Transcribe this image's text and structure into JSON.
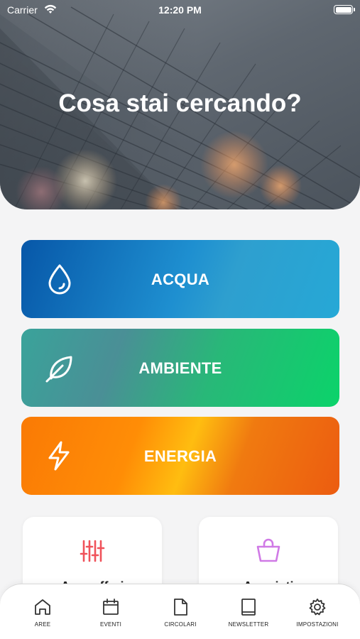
{
  "status_bar": {
    "carrier": "Carrier",
    "time": "12:20 PM"
  },
  "hero": {
    "title": "Cosa stai cercando?"
  },
  "categories": [
    {
      "label": "ACQUA",
      "icon": "water-drop-icon",
      "colors": [
        "#0757a8",
        "#26a8d6"
      ]
    },
    {
      "label": "AMBIENTE",
      "icon": "leaf-icon",
      "colors": [
        "#3aa39a",
        "#0bd36a"
      ]
    },
    {
      "label": "ENERGIA",
      "icon": "lightning-icon",
      "colors": [
        "#fa7a05",
        "#ffbd10",
        "#ec5c10"
      ]
    }
  ],
  "cards": [
    {
      "label": "Aree affari",
      "icon": "sliders-icon",
      "icon_color": "#f0525a"
    },
    {
      "label": "Acquisti",
      "icon": "shopping-bag-icon",
      "icon_color": "#d07ae6"
    }
  ],
  "tabs": [
    {
      "label": "AREE",
      "icon": "home-icon"
    },
    {
      "label": "EVENTI",
      "icon": "calendar-icon"
    },
    {
      "label": "CIRCOLARI",
      "icon": "document-icon"
    },
    {
      "label": "NEWSLETTER",
      "icon": "book-icon"
    },
    {
      "label": "IMPOSTAZIONI",
      "icon": "gear-icon"
    }
  ]
}
